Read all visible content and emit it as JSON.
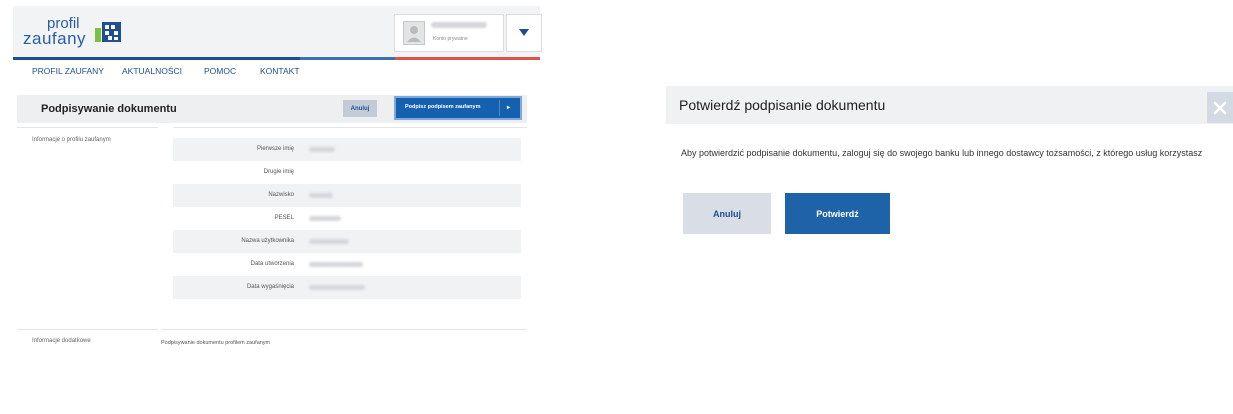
{
  "header": {
    "logo_line1": "profil",
    "logo_line2": "zaufany",
    "user_subtitle": "Konto prywatne"
  },
  "nav": [
    "PROFIL ZAUFANY",
    "AKTUALNOŚCI",
    "POMOC",
    "KONTAKT"
  ],
  "doc": {
    "title": "Podpisywanie dokumentu",
    "cancel_label": "Anuluj",
    "sign_label": "Podpisz podpisem zaufanym"
  },
  "profile_section_label": "Informacje o profilu zaufanym",
  "profile_fields": [
    "Pierwsze imię",
    "Drugie imię",
    "Nazwisko",
    "PESEL",
    "Nazwa użytkownika",
    "Data utworzenia",
    "Data wygaśnięcia"
  ],
  "additional_section_label": "Informacje dodatkowe",
  "additional_value": "Podpisywanie dokumentu profilem zaufanym",
  "modal": {
    "title": "Potwierdź podpisanie dokumentu",
    "text": "Aby potwierdzić podpisanie dokumentu, zaloguj się do swojego banku lub innego dostawcy tożsamości, z którego usług korzystasz",
    "cancel_label": "Anuluj",
    "confirm_label": "Potwierdź"
  },
  "colors": {
    "primary": "#1e63a8",
    "nav_text": "#1d4f91",
    "accent_red": "#d9534f"
  }
}
